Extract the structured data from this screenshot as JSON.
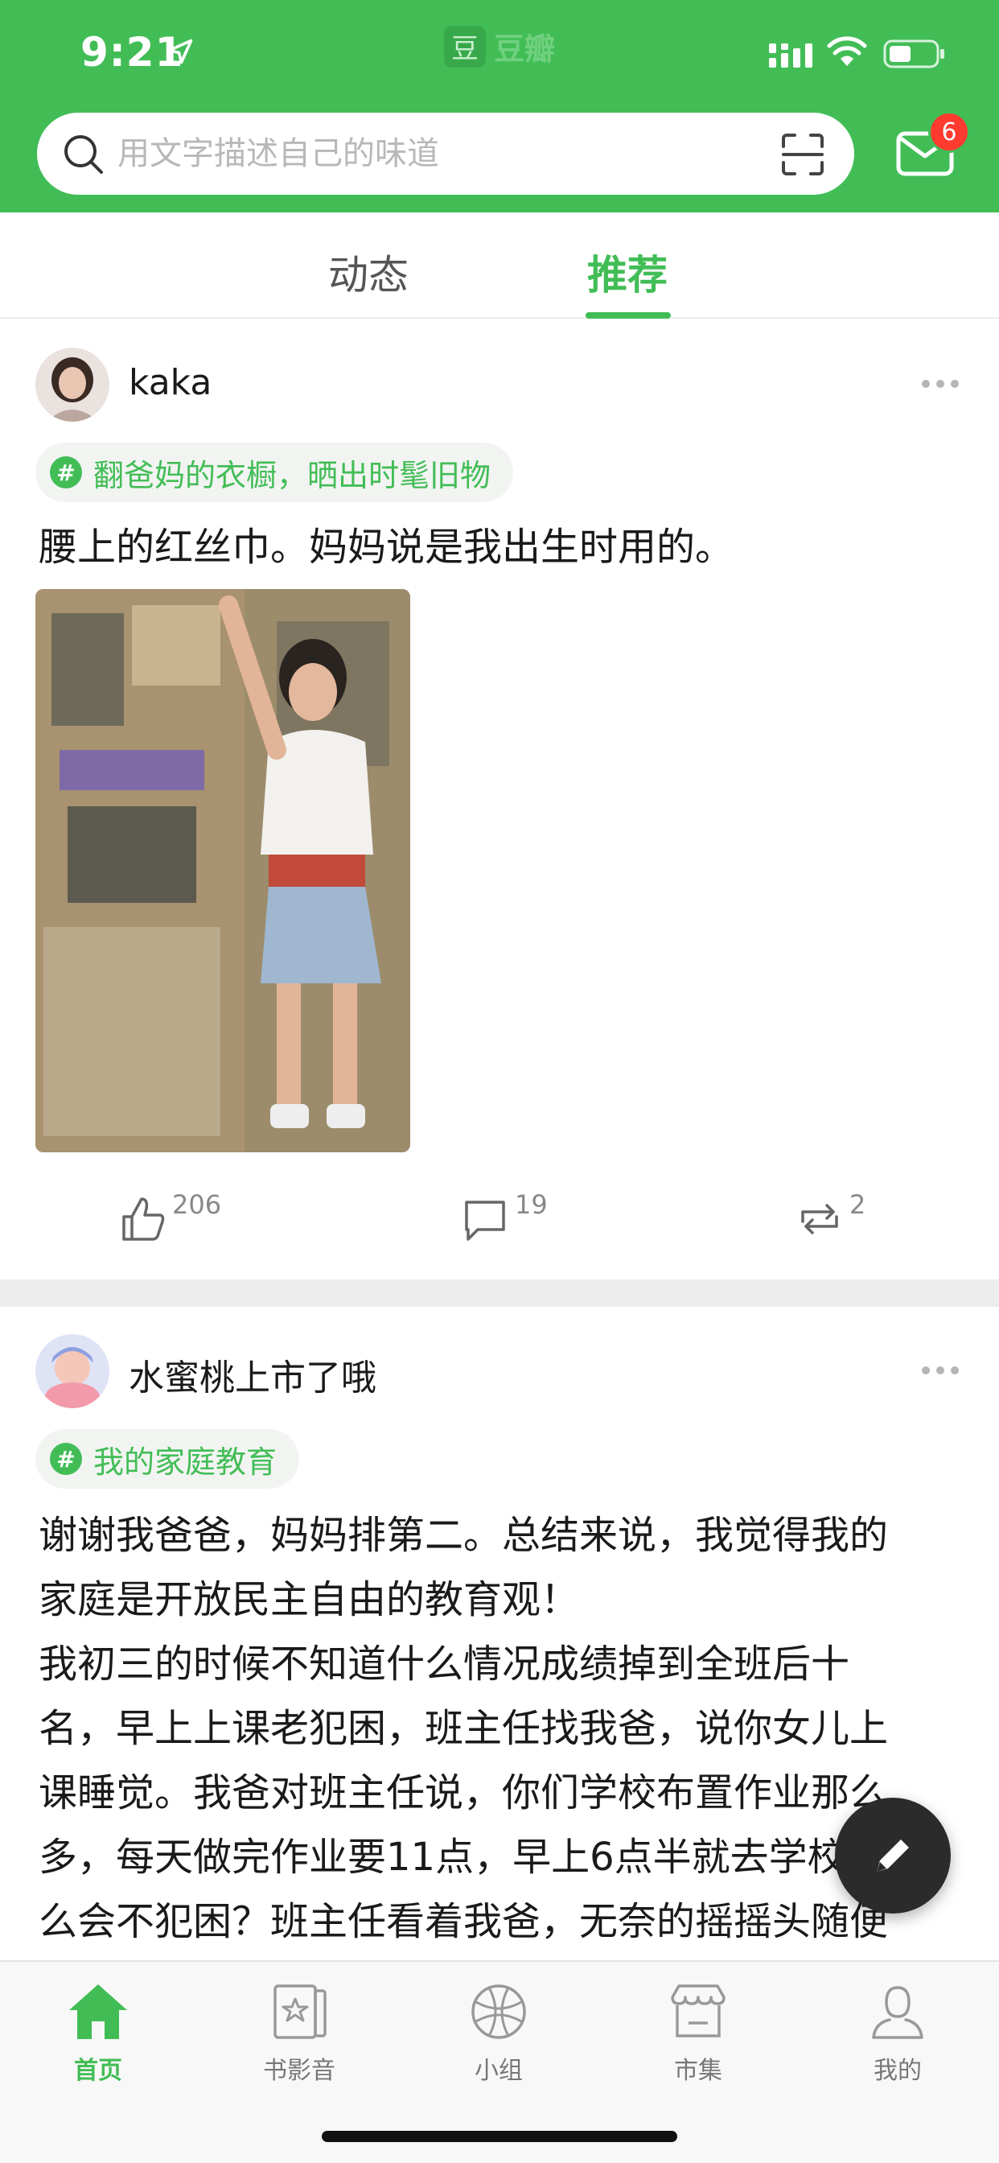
{
  "status_bar": {
    "time": "9:21"
  },
  "app": {
    "name": "豆瓣",
    "logo_char": "豆"
  },
  "search": {
    "placeholder": "用文字描述自己的味道"
  },
  "mail": {
    "badge_count": "6"
  },
  "tabs": [
    {
      "label": "动态",
      "active": false
    },
    {
      "label": "推荐",
      "active": true
    }
  ],
  "posts": [
    {
      "username": "kaka",
      "topic": "翻爸妈的衣橱，晒出时髦旧物",
      "text": "腰上的红丝巾。妈妈说是我出生时用的。",
      "likes": "206",
      "comments": "19",
      "shares": "2"
    },
    {
      "username": "水蜜桃上市了哦",
      "topic": "我的家庭教育",
      "text": "谢谢我爸爸，妈妈排第二。总结来说，我觉得我的家庭是开放民主自由的教育观！\n我初三的时候不知道什么情况成绩掉到全班后十名，早上上课老犯困，班主任找我爸，说你女儿上课睡觉。我爸对班主任说，你们学校布置作业那么多，每天做完作业要11点，早上6点半就去学校，怎么会不犯困？班主任看着我爸，无奈的摇摇头随便你吧"
    }
  ],
  "bottom_nav": [
    {
      "label": "首页",
      "icon": "home-icon",
      "active": true
    },
    {
      "label": "书影音",
      "icon": "media-icon",
      "active": false
    },
    {
      "label": "小组",
      "icon": "group-icon",
      "active": false
    },
    {
      "label": "市集",
      "icon": "market-icon",
      "active": false
    },
    {
      "label": "我的",
      "icon": "profile-icon",
      "active": false
    }
  ],
  "colors": {
    "brand": "#42bd56",
    "badge": "#ff3b30",
    "fab": "#2b2b2b"
  }
}
